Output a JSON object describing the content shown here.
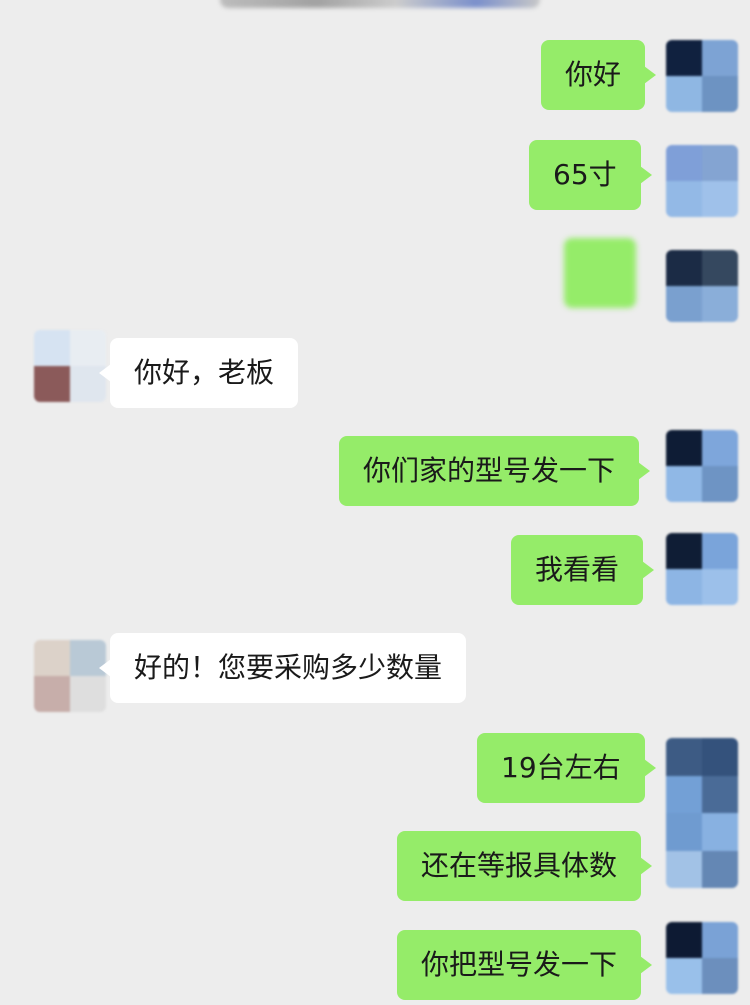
{
  "messages": [
    {
      "side": "out",
      "text": "你好"
    },
    {
      "side": "out",
      "text": "65寸"
    },
    {
      "side": "out",
      "text": ""
    },
    {
      "side": "in",
      "text": "你好，老板"
    },
    {
      "side": "out",
      "text": "你们家的型号发一下"
    },
    {
      "side": "out",
      "text": "我看看"
    },
    {
      "side": "in",
      "text": "好的！您要采购多少数量"
    },
    {
      "side": "out",
      "text": "19台左右"
    },
    {
      "side": "out",
      "text": "还在等报具体数"
    },
    {
      "side": "out",
      "text": "你把型号发一下"
    }
  ],
  "colors": {
    "background": "#ededed",
    "outgoing_bubble": "#95ec69",
    "incoming_bubble": "#ffffff",
    "text": "#1a1a1a"
  }
}
